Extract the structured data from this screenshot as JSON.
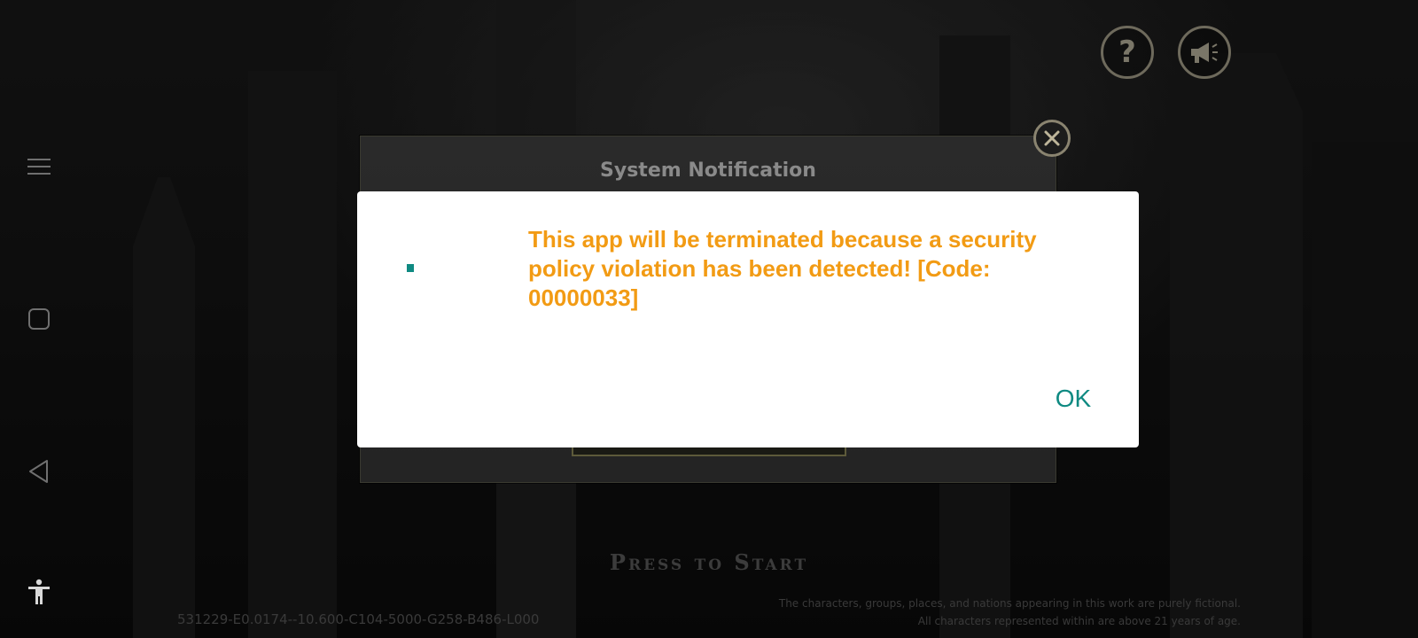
{
  "background": {
    "press_to_start": "Press to Start",
    "version_string": "531229-E0.0174--10.600-C104-5000-G258-B486-L000",
    "disclaimer_line1": "The characters, groups, places, and nations appearing in this work are purely fictional.",
    "disclaimer_line2": "All characters represented within are above 21 years of age."
  },
  "top_buttons": {
    "help_icon": "question-mark-icon",
    "notice_icon": "megaphone-icon"
  },
  "system_panel": {
    "title": "System Notification",
    "close_icon": "close-circle-icon"
  },
  "nav_bar": {
    "icons": [
      "menu-icon",
      "home-square-icon",
      "back-triangle-icon",
      "accessibility-icon"
    ]
  },
  "dialog": {
    "message": "This app will be terminated because a security policy violation has been detected! [Code: 00000033]",
    "ok_label": "OK"
  },
  "colors": {
    "message": "#f29b14",
    "ok": "#0f8a82",
    "dialog_bg": "#ffffff"
  }
}
